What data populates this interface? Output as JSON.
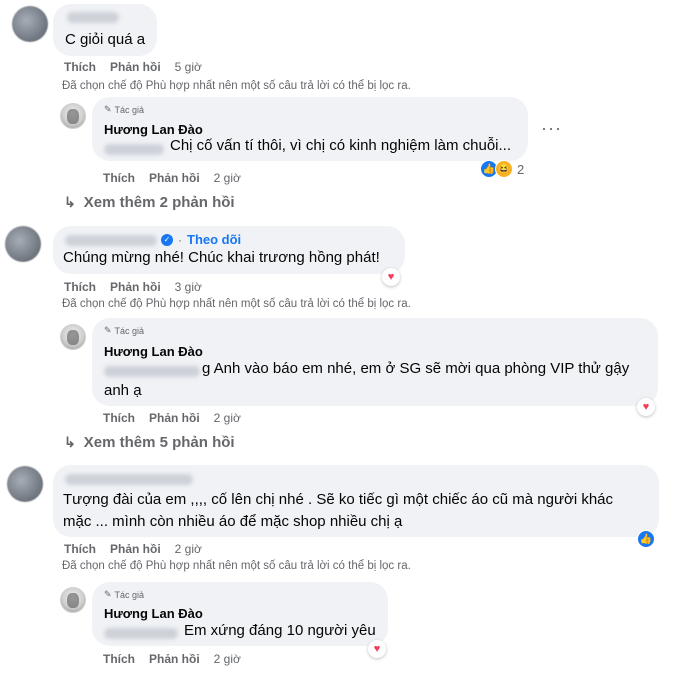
{
  "actions": {
    "like": "Thích",
    "reply": "Phản hồi"
  },
  "author_badge": "Tác giả",
  "filter_note": "Đã chọn chế độ Phù hợp nhất nên một số câu trả lời có thể bị lọc ra.",
  "threads": [
    {
      "comment": {
        "text": "C giỏi quá a",
        "time": "5 giờ"
      },
      "reply": {
        "name": "Hương Lan Đào",
        "text": "Chị cố vấn tí thôi, vì chị có kinh nghiệm làm chuỗi...",
        "time": "2 giờ",
        "reaction_count": "2"
      },
      "more_replies": "Xem thêm 2 phản hồi"
    },
    {
      "comment": {
        "follow": "Theo dõi",
        "text": "Chúng mừng nhé! Chúc khai trương hồng phát!",
        "time": "3 giờ"
      },
      "reply": {
        "name": "Hương Lan Đào",
        "text_line1": "g Anh vào báo em nhé, em ở SG sẽ mời qua phòng VIP thử gậy",
        "text_line2": "anh ạ",
        "time": "2 giờ"
      },
      "more_replies": "Xem thêm 5 phản hồi"
    },
    {
      "comment": {
        "text_line1": "Tượng đài của em ,,,, cố lên chị nhé . Sẽ ko tiếc gì một chiếc áo cũ mà người khác",
        "text_line2": "mặc ... mình còn nhiều áo để mặc shop nhiều chị ạ",
        "time": "2 giờ"
      },
      "reply": {
        "name": "Hương Lan Đào",
        "text": "Em xứng đáng 10 người yêu",
        "time": "2 giờ"
      }
    }
  ],
  "icons": {
    "heart": "♥",
    "like": "👍",
    "haha": "😆",
    "pencil": "✎",
    "reply_arrow": "↳",
    "more": "···",
    "verified": "✓"
  }
}
